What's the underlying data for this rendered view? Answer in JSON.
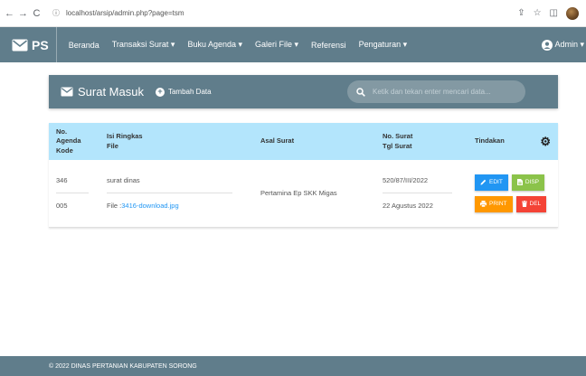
{
  "browser": {
    "back": "←",
    "forward": "→",
    "reload": "C",
    "info_icon": "ⓘ",
    "url": "localhost/arsip/admin.php?page=tsm",
    "share_icon": "⇪",
    "star_icon": "☆",
    "sidebar_icon": "◫"
  },
  "navbar": {
    "brand": "PS",
    "items": [
      "Beranda",
      "Transaksi Surat ▾",
      "Buku Agenda ▾",
      "Galeri File ▾",
      "Referensi",
      "Pengaturan ▾"
    ],
    "user": "Admin ▾"
  },
  "card": {
    "title": "Surat Masuk",
    "add_label": "Tambah Data",
    "search_placeholder": "Ketik dan tekan enter mencari data..."
  },
  "table": {
    "headers": {
      "col1_line1": "No. Agenda",
      "col1_line2": "Kode",
      "col2_line1": "Isi Ringkas",
      "col2_line2": "File",
      "col3": "Asal Surat",
      "col4_line1": "No. Surat",
      "col4_line2": "Tgl Surat",
      "col5": "Tindakan"
    },
    "rows": [
      {
        "no_agenda": "346",
        "kode": "005",
        "isi": "surat dinas",
        "file_label": "File : ",
        "file_name": "3416-download.jpg",
        "asal": "Pertamina Ep SKK Migas",
        "no_surat": "520/87/III/2022",
        "tgl_surat": "22 Agustus 2022",
        "edit": "EDIT",
        "disp": "DISP",
        "print": "PRINT",
        "del": "DEL"
      }
    ]
  },
  "footer": {
    "text": "© 2022 DINAS PERTANIAN KABUPATEN SORONG"
  },
  "colors": {
    "primary": "#607d8b",
    "table_header": "#b3e5fc",
    "edit": "#2196f3",
    "disp": "#8bc34a",
    "print": "#ff9800",
    "del": "#f44336"
  }
}
